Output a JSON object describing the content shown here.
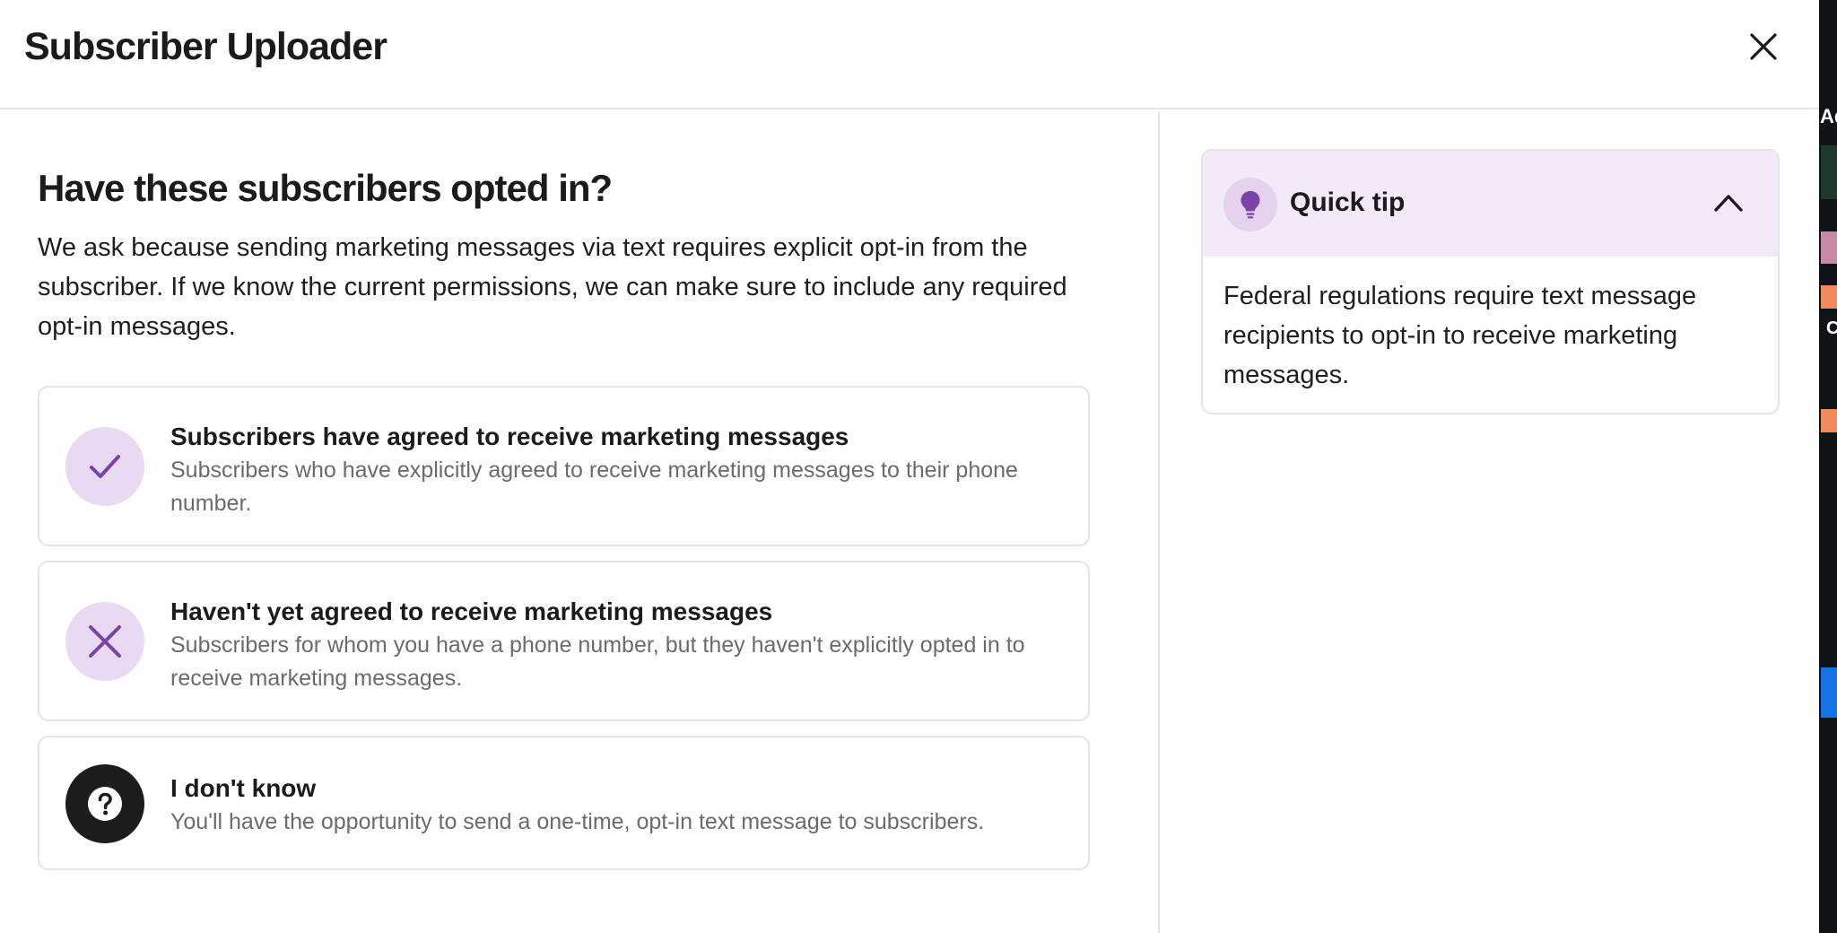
{
  "header": {
    "title": "Subscriber Uploader",
    "close_icon": "close-icon"
  },
  "main": {
    "question": "Have these subscribers opted in?",
    "explanation": "We ask because sending marketing messages via text requires explicit opt-in from the subscriber. If we know the current permissions, we can make sure to include any required opt-in messages.",
    "options": [
      {
        "icon": "check-icon",
        "title": "Subscribers have agreed to receive marketing messages",
        "description": "Subscribers who have explicitly agreed to receive marketing messages to their phone number."
      },
      {
        "icon": "x-icon",
        "title": "Haven't yet agreed to receive marketing messages",
        "description": "Subscribers for whom you have a phone number, but they haven't explicitly opted in to receive marketing messages."
      },
      {
        "icon": "question-icon",
        "title": "I don't know",
        "description": "You'll have the opportunity to send a one-time, opt-in text message to subscribers."
      }
    ]
  },
  "tip": {
    "icon": "lightbulb-icon",
    "title": "Quick tip",
    "toggle_icon": "chevron-up-icon",
    "body": "Federal regulations require text message recipients to opt-in to receive marketing messages."
  },
  "background_edge": {
    "text_top": "Ad",
    "text_mid": "C"
  },
  "colors": {
    "accent_purple": "#7a43a8",
    "icon_bg_purple": "#ead9f2",
    "tip_header_bg": "#f3e9f8",
    "dark_icon_bg": "#1c1c1c",
    "border": "#e4e4e4",
    "muted_text": "#6b6b6b"
  }
}
